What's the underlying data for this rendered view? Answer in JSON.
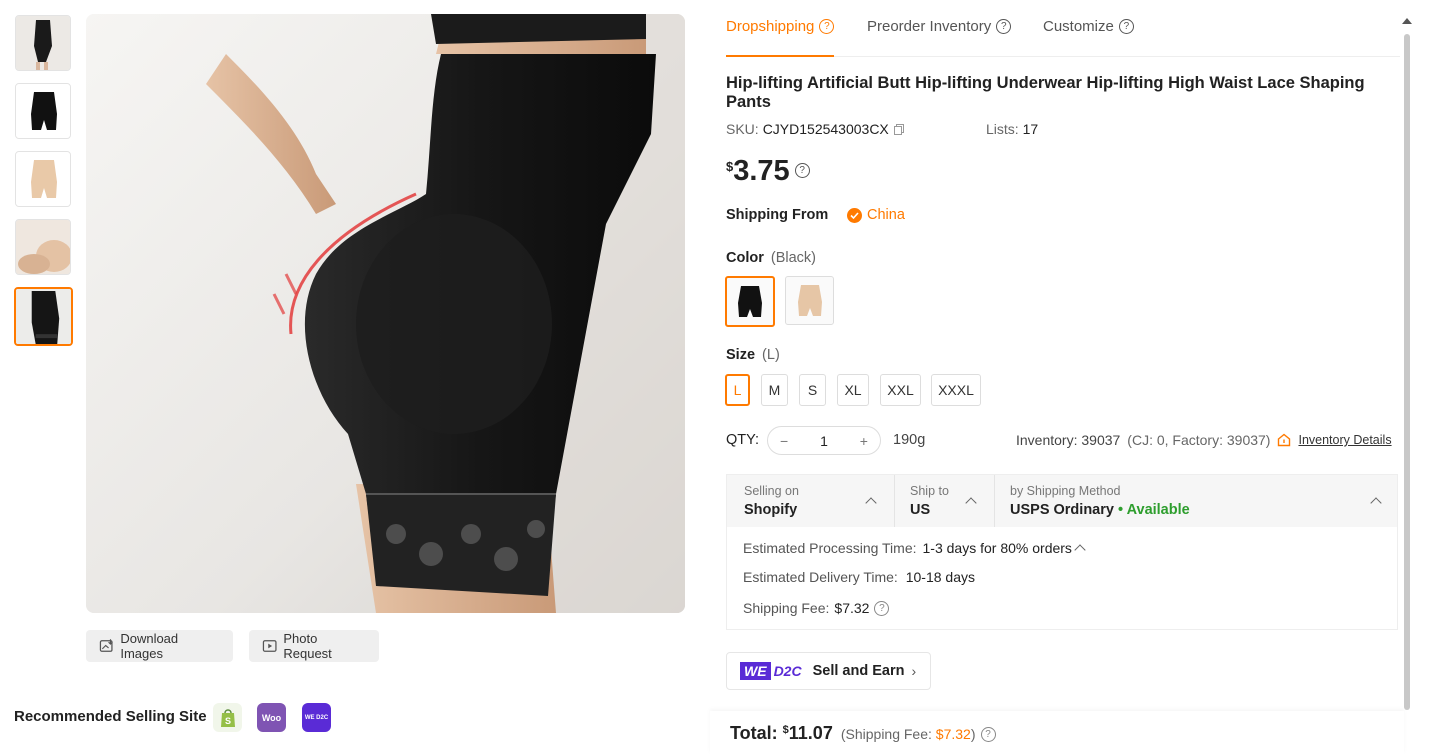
{
  "thumbnails": [
    {
      "name": "thumb-1",
      "active": false
    },
    {
      "name": "thumb-2",
      "active": false
    },
    {
      "name": "thumb-3",
      "active": false
    },
    {
      "name": "thumb-4",
      "active": false
    },
    {
      "name": "thumb-5",
      "active": true
    }
  ],
  "gallery": {
    "download_label": "Download Images",
    "photo_request_label": "Photo Request"
  },
  "recommended": {
    "title": "Recommended Selling Site",
    "sites": [
      "shopify-icon",
      "woocommerce-icon",
      "wed2c-icon"
    ],
    "woo_text": "Woo",
    "wed2c_text": "WE D2C"
  },
  "tabs": [
    {
      "label": "Dropshipping",
      "active": true
    },
    {
      "label": "Preorder Inventory",
      "active": false
    },
    {
      "label": "Customize",
      "active": false
    }
  ],
  "product": {
    "title": "Hip-lifting Artificial Butt Hip-lifting Underwear Hip-lifting High Waist Lace Shaping Pants",
    "sku_label": "SKU:",
    "sku": "CJYD152543003CX",
    "lists_label": "Lists:",
    "lists": "17",
    "currency": "$",
    "price": "3.75",
    "shipping_from_label": "Shipping From",
    "shipping_from": "China",
    "color_label": "Color",
    "color_selected": "(Black)",
    "size_label": "Size",
    "size_selected": "(L)",
    "sizes": [
      "L",
      "M",
      "S",
      "XL",
      "XXL",
      "XXXL"
    ],
    "qty_label": "QTY:",
    "qty_minus": "−",
    "qty_value": "1",
    "qty_plus": "+",
    "weight": "190g",
    "inventory_text": "Inventory: 39037",
    "inventory_detail": "(CJ: 0, Factory: 39037)",
    "inventory_link": "Inventory Details"
  },
  "shipping": {
    "selling_on_label": "Selling on",
    "selling_on": "Shopify",
    "ship_to_label": "Ship to",
    "ship_to": "US",
    "method_label": "by Shipping Method",
    "method": "USPS Ordinary",
    "availability": "• Available",
    "processing_label": "Estimated Processing Time:",
    "processing": "1-3 days for 80% orders",
    "delivery_label": "Estimated Delivery Time:",
    "delivery": "10-18 days",
    "fee_label": "Shipping Fee:",
    "fee": "$7.32"
  },
  "d2c": {
    "logo_we": "WE",
    "logo_d2c": "D2C",
    "label": "Sell and Earn"
  },
  "total": {
    "label": "Total:",
    "currency": "$",
    "amount": "11.07",
    "fee_prefix": "(Shipping Fee: ",
    "fee": "$7.32",
    "fee_suffix": ")"
  },
  "colors": {
    "accent": "#ff7a00",
    "available": "#2e9e2e",
    "wed2c": "#5a2bd6",
    "woo": "#7f54b3",
    "shopify": "#95bf47"
  }
}
